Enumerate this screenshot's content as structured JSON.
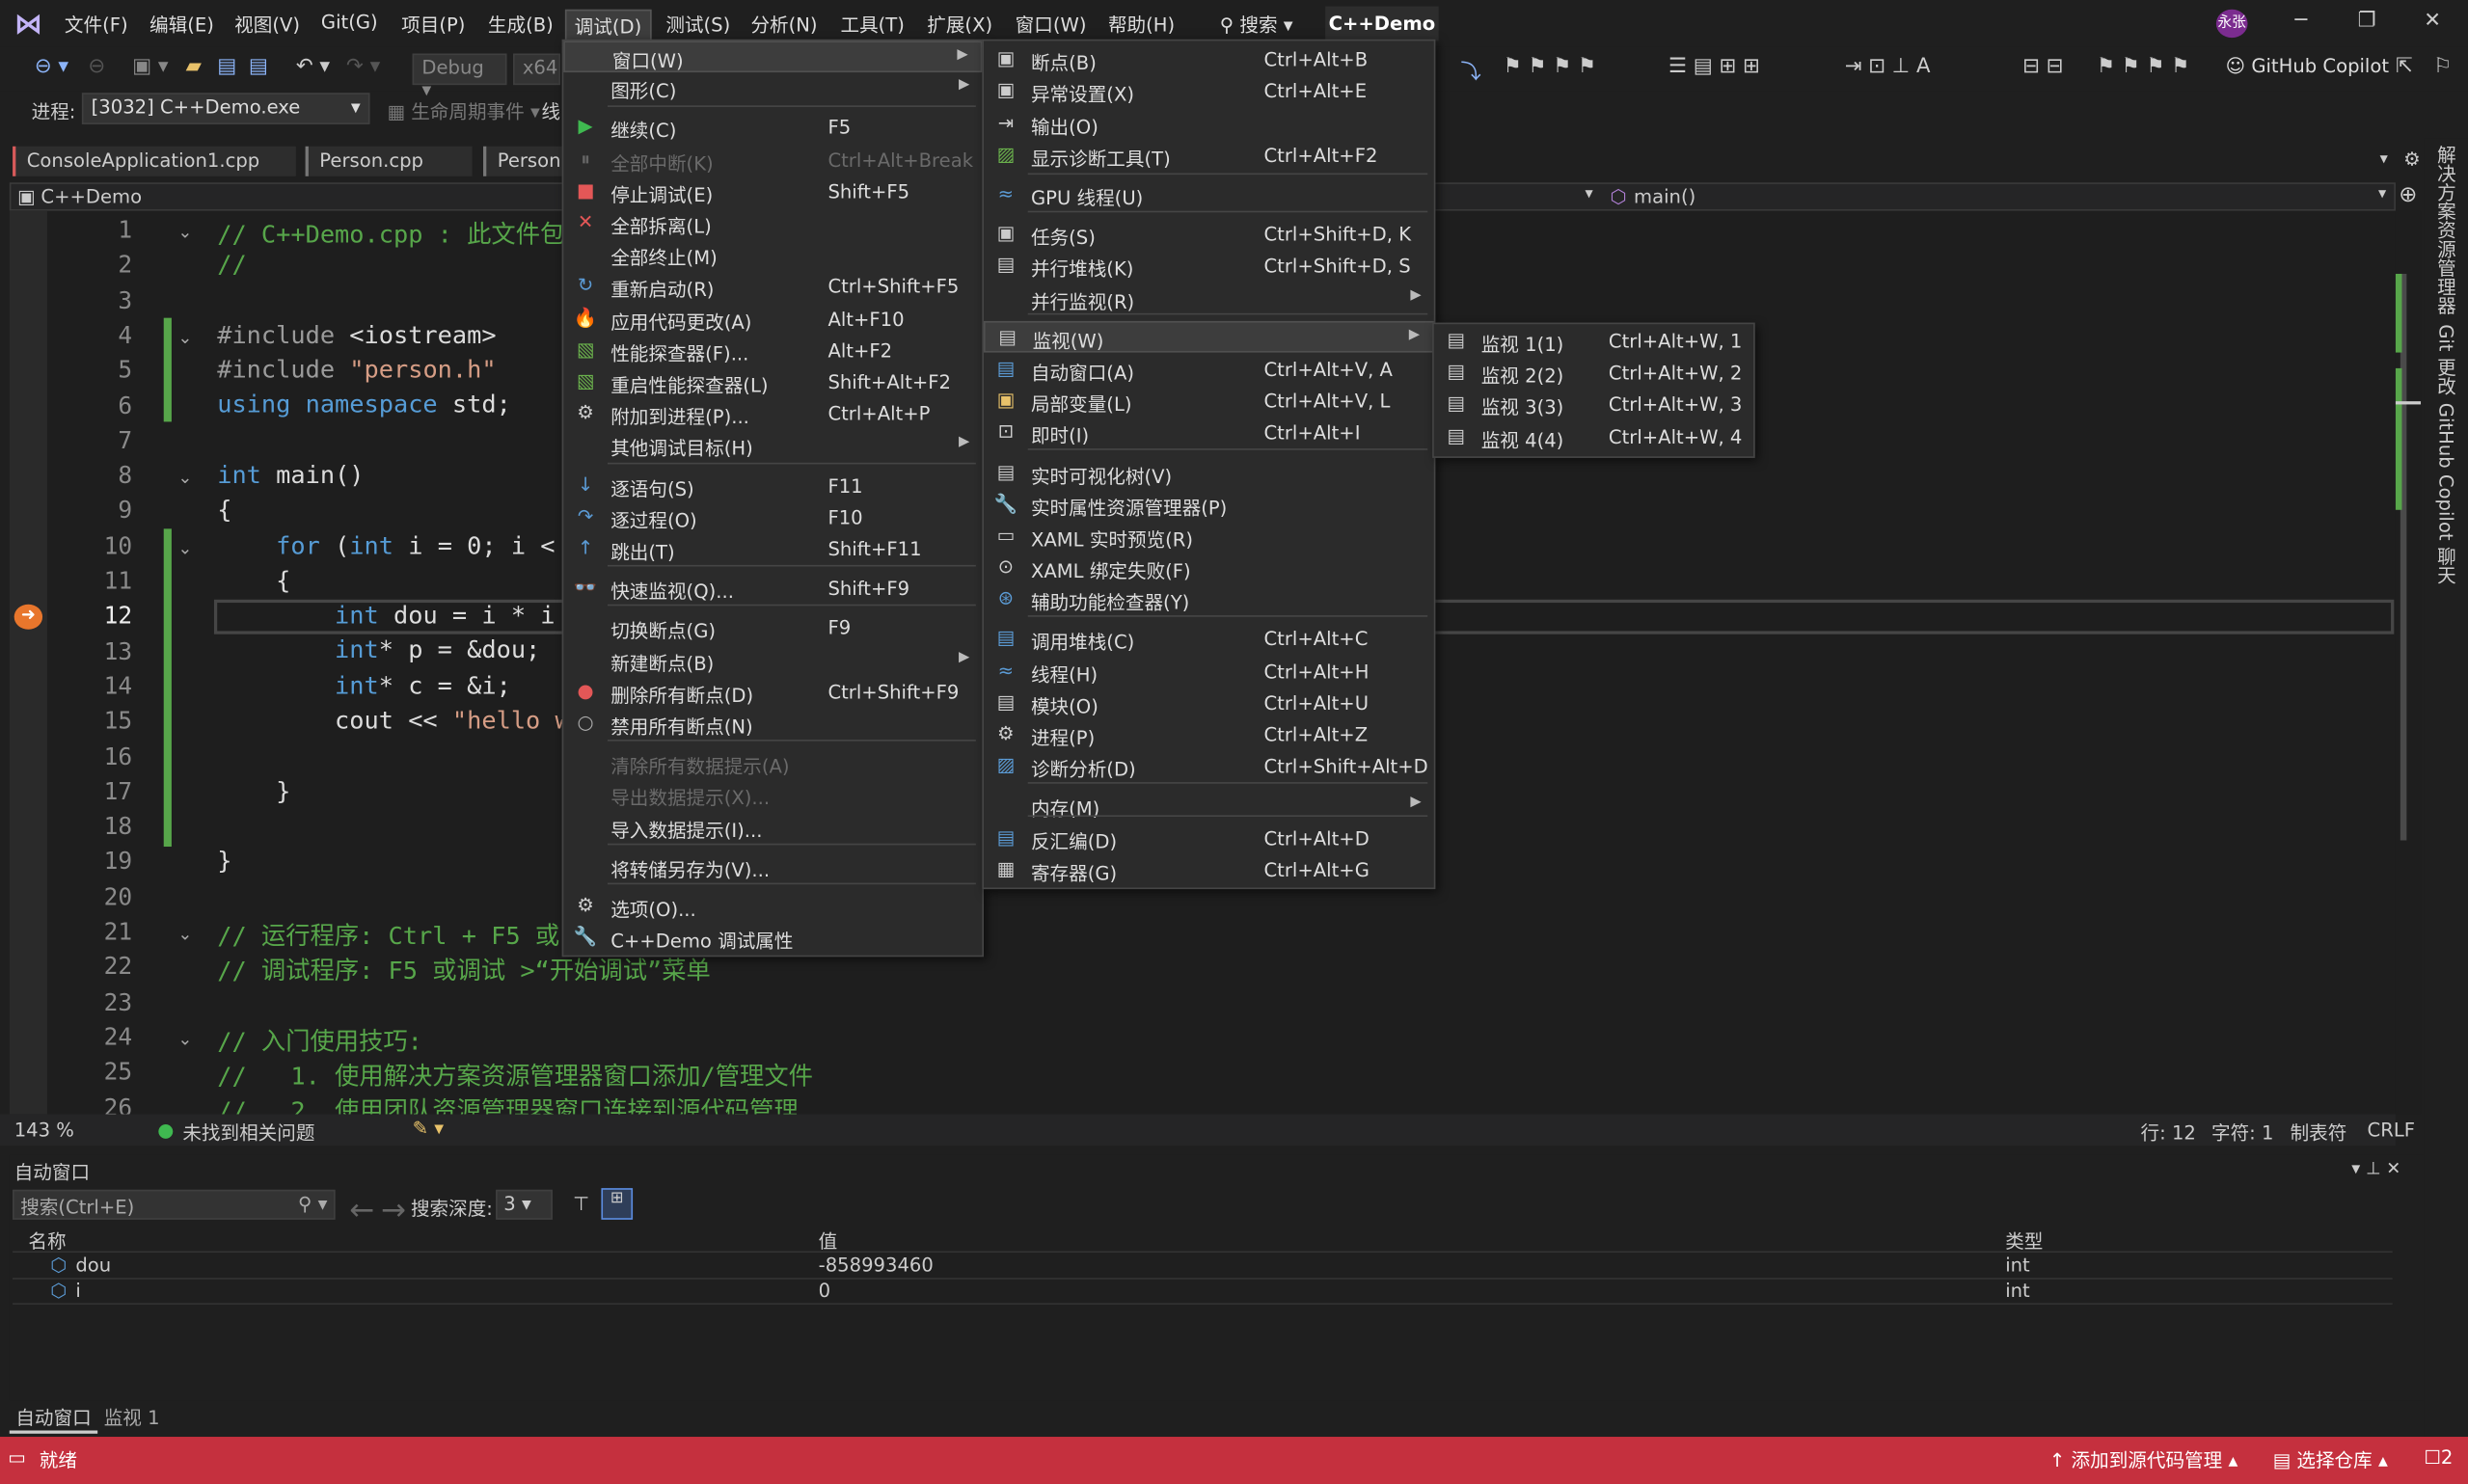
{
  "app": {
    "logo": "vs-logo",
    "title": "C++Demo",
    "user_badge": "永张"
  },
  "menus": [
    "文件(F)",
    "编辑(E)",
    "视图(V)",
    "Git(G)",
    "项目(P)",
    "生成(B)",
    "调试(D)",
    "测试(S)",
    "分析(N)",
    "工具(T)",
    "扩展(X)",
    "窗口(W)",
    "帮助(H)"
  ],
  "search": "搜索",
  "toolbar": {
    "config": "Debug",
    "platform": "x64",
    "copilot": "GitHub Copilot"
  },
  "process": {
    "label": "进程:",
    "value": "[3032] C++Demo.exe",
    "lifecycle": "生命周期事件",
    "thread": "线"
  },
  "tabs": [
    "ConsoleApplication1.cpp",
    "Person.cpp",
    "Person.h"
  ],
  "nav": {
    "project": "C++Demo",
    "func": "main()"
  },
  "code": {
    "lines": [
      "1",
      "2",
      "3",
      "4",
      "5",
      "6",
      "7",
      "8",
      "9",
      "10",
      "11",
      "12",
      "13",
      "14",
      "15",
      "16",
      "17",
      "18",
      "19",
      "20",
      "21",
      "22",
      "23",
      "24",
      "25",
      "26"
    ]
  },
  "status_line": {
    "zoom": "143 %",
    "issues": "未找到相关问题",
    "row": "行: 12",
    "col": "字符: 1",
    "tabs": "制表符",
    "eol": "CRLF"
  },
  "debug_menu": {
    "items": [
      {
        "label": "窗口(W)",
        "sc": "",
        "arrow": true,
        "hl": true
      },
      {
        "label": "图形(C)",
        "sc": "",
        "arrow": true
      },
      {
        "label": "继续(C)",
        "sc": "F5"
      },
      {
        "label": "全部中断(K)",
        "sc": "Ctrl+Alt+Break",
        "dis": true
      },
      {
        "label": "停止调试(E)",
        "sc": "Shift+F5"
      },
      {
        "label": "全部拆离(L)",
        "sc": ""
      },
      {
        "label": "全部终止(M)",
        "sc": ""
      },
      {
        "label": "重新启动(R)",
        "sc": "Ctrl+Shift+F5"
      },
      {
        "label": "应用代码更改(A)",
        "sc": "Alt+F10"
      },
      {
        "label": "性能探查器(F)...",
        "sc": "Alt+F2"
      },
      {
        "label": "重启性能探查器(L)",
        "sc": "Shift+Alt+F2"
      },
      {
        "label": "附加到进程(P)...",
        "sc": "Ctrl+Alt+P"
      },
      {
        "label": "其他调试目标(H)",
        "sc": "",
        "arrow": true
      },
      {
        "label": "逐语句(S)",
        "sc": "F11"
      },
      {
        "label": "逐过程(O)",
        "sc": "F10"
      },
      {
        "label": "跳出(T)",
        "sc": "Shift+F11"
      },
      {
        "label": "快速监视(Q)...",
        "sc": "Shift+F9"
      },
      {
        "label": "切换断点(G)",
        "sc": "F9"
      },
      {
        "label": "新建断点(B)",
        "sc": "",
        "arrow": true
      },
      {
        "label": "删除所有断点(D)",
        "sc": "Ctrl+Shift+F9"
      },
      {
        "label": "禁用所有断点(N)",
        "sc": ""
      },
      {
        "label": "清除所有数据提示(A)",
        "sc": "",
        "dis": true
      },
      {
        "label": "导出数据提示(X)...",
        "sc": "",
        "dis": true
      },
      {
        "label": "导入数据提示(I)...",
        "sc": ""
      },
      {
        "label": "将转储另存为(V)...",
        "sc": ""
      },
      {
        "label": "选项(O)...",
        "sc": ""
      },
      {
        "label": "C++Demo 调试属性",
        "sc": ""
      }
    ]
  },
  "window_menu": {
    "items": [
      {
        "label": "断点(B)",
        "sc": "Ctrl+Alt+B"
      },
      {
        "label": "异常设置(X)",
        "sc": "Ctrl+Alt+E"
      },
      {
        "label": "输出(O)",
        "sc": ""
      },
      {
        "label": "显示诊断工具(T)",
        "sc": "Ctrl+Alt+F2"
      },
      {
        "label": "GPU 线程(U)",
        "sc": ""
      },
      {
        "label": "任务(S)",
        "sc": "Ctrl+Shift+D, K"
      },
      {
        "label": "并行堆栈(K)",
        "sc": "Ctrl+Shift+D, S"
      },
      {
        "label": "并行监视(R)",
        "sc": "",
        "arrow": true
      },
      {
        "label": "监视(W)",
        "sc": "",
        "arrow": true,
        "hl": true
      },
      {
        "label": "自动窗口(A)",
        "sc": "Ctrl+Alt+V, A"
      },
      {
        "label": "局部变量(L)",
        "sc": "Ctrl+Alt+V, L"
      },
      {
        "label": "即时(I)",
        "sc": "Ctrl+Alt+I"
      },
      {
        "label": "实时可视化树(V)",
        "sc": ""
      },
      {
        "label": "实时属性资源管理器(P)",
        "sc": ""
      },
      {
        "label": "XAML 实时预览(R)",
        "sc": ""
      },
      {
        "label": "XAML 绑定失败(F)",
        "sc": ""
      },
      {
        "label": "辅助功能检查器(Y)",
        "sc": ""
      },
      {
        "label": "调用堆栈(C)",
        "sc": "Ctrl+Alt+C"
      },
      {
        "label": "线程(H)",
        "sc": "Ctrl+Alt+H"
      },
      {
        "label": "模块(O)",
        "sc": "Ctrl+Alt+U"
      },
      {
        "label": "进程(P)",
        "sc": "Ctrl+Alt+Z"
      },
      {
        "label": "诊断分析(D)",
        "sc": "Ctrl+Shift+Alt+D"
      },
      {
        "label": "内存(M)",
        "sc": "",
        "arrow": true
      },
      {
        "label": "反汇编(D)",
        "sc": "Ctrl+Alt+D"
      },
      {
        "label": "寄存器(G)",
        "sc": "Ctrl+Alt+G"
      }
    ]
  },
  "watch_menu": {
    "items": [
      {
        "label": "监视 1(1)",
        "sc": "Ctrl+Alt+W, 1"
      },
      {
        "label": "监视 2(2)",
        "sc": "Ctrl+Alt+W, 2"
      },
      {
        "label": "监视 3(3)",
        "sc": "Ctrl+Alt+W, 3"
      },
      {
        "label": "监视 4(4)",
        "sc": "Ctrl+Alt+W, 4"
      }
    ]
  },
  "autos": {
    "title": "自动窗口",
    "search": "搜索(Ctrl+E)",
    "depth_label": "搜索深度:",
    "depth": "3",
    "cols": [
      "名称",
      "值",
      "类型"
    ],
    "rows": [
      [
        "dou",
        "-858993460",
        "int"
      ],
      [
        "i",
        "0",
        "int"
      ]
    ]
  },
  "bottom_tabs": [
    "自动窗口",
    "监视 1"
  ],
  "statusbar": {
    "ready": "就绪",
    "add_source": "添加到源代码管理",
    "select_repo": "选择仓库",
    "notif": "2"
  },
  "right_tabs": [
    "解决方案资源管理器",
    "Git 更改",
    "GitHub Copilot 聊天"
  ]
}
